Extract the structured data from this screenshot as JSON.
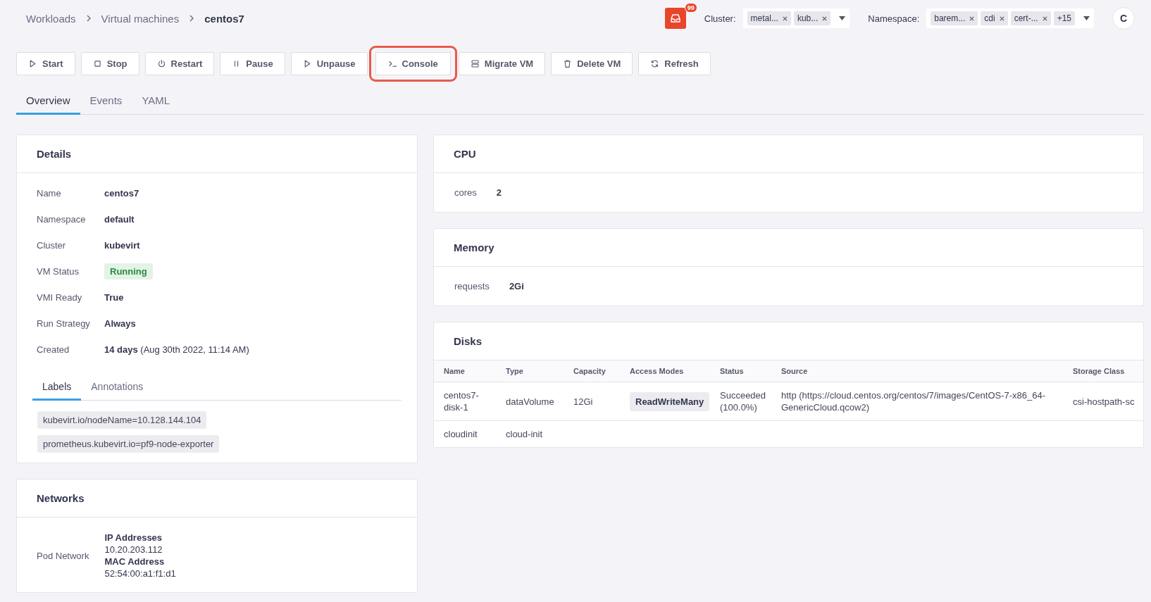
{
  "breadcrumb": [
    "Workloads",
    "Virtual machines",
    "centos7"
  ],
  "notifications": {
    "count": "99"
  },
  "cluster_filter": {
    "label": "Cluster:",
    "chips": [
      "metal...",
      "kub..."
    ]
  },
  "namespace_filter": {
    "label": "Namespace:",
    "chips": [
      "barem...",
      "cdi",
      "cert-..."
    ],
    "more": "+15"
  },
  "user": {
    "initial": "C"
  },
  "actions": [
    {
      "label": "Start",
      "kind": "play",
      "highlighted": false
    },
    {
      "label": "Stop",
      "kind": "stop",
      "highlighted": false
    },
    {
      "label": "Restart",
      "kind": "power",
      "highlighted": false
    },
    {
      "label": "Pause",
      "kind": "pause",
      "highlighted": false
    },
    {
      "label": "Unpause",
      "kind": "play",
      "highlighted": false
    },
    {
      "label": "Console",
      "kind": "terminal",
      "highlighted": true
    },
    {
      "label": "Migrate VM",
      "kind": "server",
      "highlighted": false
    },
    {
      "label": "Delete VM",
      "kind": "trash",
      "highlighted": false
    },
    {
      "label": "Refresh",
      "kind": "refresh",
      "highlighted": false
    }
  ],
  "tabs": [
    {
      "label": "Overview",
      "selected": true
    },
    {
      "label": "Events",
      "selected": false
    },
    {
      "label": "YAML",
      "selected": false
    }
  ],
  "details": {
    "title": "Details",
    "fields": [
      {
        "label": "Name",
        "value": "centos7",
        "kind": "bold"
      },
      {
        "label": "Namespace",
        "value": "default",
        "kind": "bold"
      },
      {
        "label": "Cluster",
        "value": "kubevirt",
        "kind": "bold"
      },
      {
        "label": "VM Status",
        "value": "Running",
        "kind": "status"
      },
      {
        "label": "VMI Ready",
        "value": "True",
        "kind": "bold"
      },
      {
        "label": "Run Strategy",
        "value": "Always",
        "kind": "bold"
      },
      {
        "label": "Created",
        "value": "**14 days** (Aug 30th 2022, 11:14 AM)",
        "kind": "rich"
      }
    ],
    "tabs": [
      {
        "label": "Labels",
        "selected": true
      },
      {
        "label": "Annotations",
        "selected": false
      }
    ],
    "labels": [
      "kubevirt.io/nodeName=10.128.144.104",
      "prometheus.kubevirt.io=pf9-node-exporter"
    ]
  },
  "networks": {
    "title": "Networks",
    "items": [
      {
        "name": "Pod Network",
        "ip_heading": "IP Addresses",
        "ip": "10.20.203.112",
        "mac_heading": "MAC Address",
        "mac": "52:54:00:a1:f1:d1"
      }
    ]
  },
  "cpu": {
    "title": "CPU",
    "fields": [
      {
        "label": "cores",
        "value": "2"
      }
    ]
  },
  "memory": {
    "title": "Memory",
    "fields": [
      {
        "label": "requests",
        "value": "2Gi"
      }
    ]
  },
  "disks": {
    "title": "Disks",
    "columns": [
      "Name",
      "Type",
      "Capacity",
      "Access Modes",
      "Status",
      "Source",
      "Storage Class"
    ],
    "rows": [
      [
        "centos7-disk-1",
        "dataVolume",
        "12Gi",
        "ReadWriteMany",
        "Succeeded (100.0%)",
        "http (https://cloud.centos.org/centos/7/images/CentOS-7-x86_64-GenericCloud.qcow2)",
        "csi-hostpath-sc"
      ],
      [
        "cloudinit",
        "cloud-init",
        "",
        "",
        "",
        "",
        ""
      ]
    ]
  }
}
